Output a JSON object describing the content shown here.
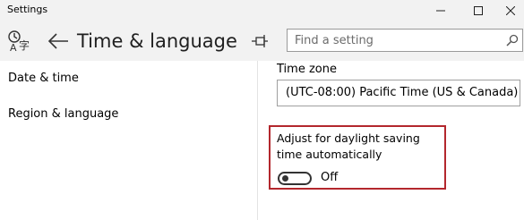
{
  "window": {
    "title": "Settings",
    "minimize_glyph": "─",
    "maximize_glyph": "☐",
    "close_glyph": "✕"
  },
  "header": {
    "page_title": "Time & language",
    "search_placeholder": "Find a setting",
    "icons": [
      "time-language-icon",
      "back-arrow-icon",
      "pin-icon",
      "search-icon"
    ]
  },
  "sidebar": {
    "items": [
      {
        "label": "Date & time"
      },
      {
        "label": "Region & language"
      }
    ]
  },
  "main": {
    "time_zone": {
      "label": "Time zone",
      "value": "(UTC-08:00) Pacific Time (US & Canada)"
    },
    "daylight_saving": {
      "label": "Adjust for daylight saving time automatically",
      "state_label": "Off",
      "enabled": false
    }
  },
  "colors": {
    "header_bg": "#f2f2f2",
    "highlight_border": "#b3272d",
    "toggle_off": "#333333"
  }
}
